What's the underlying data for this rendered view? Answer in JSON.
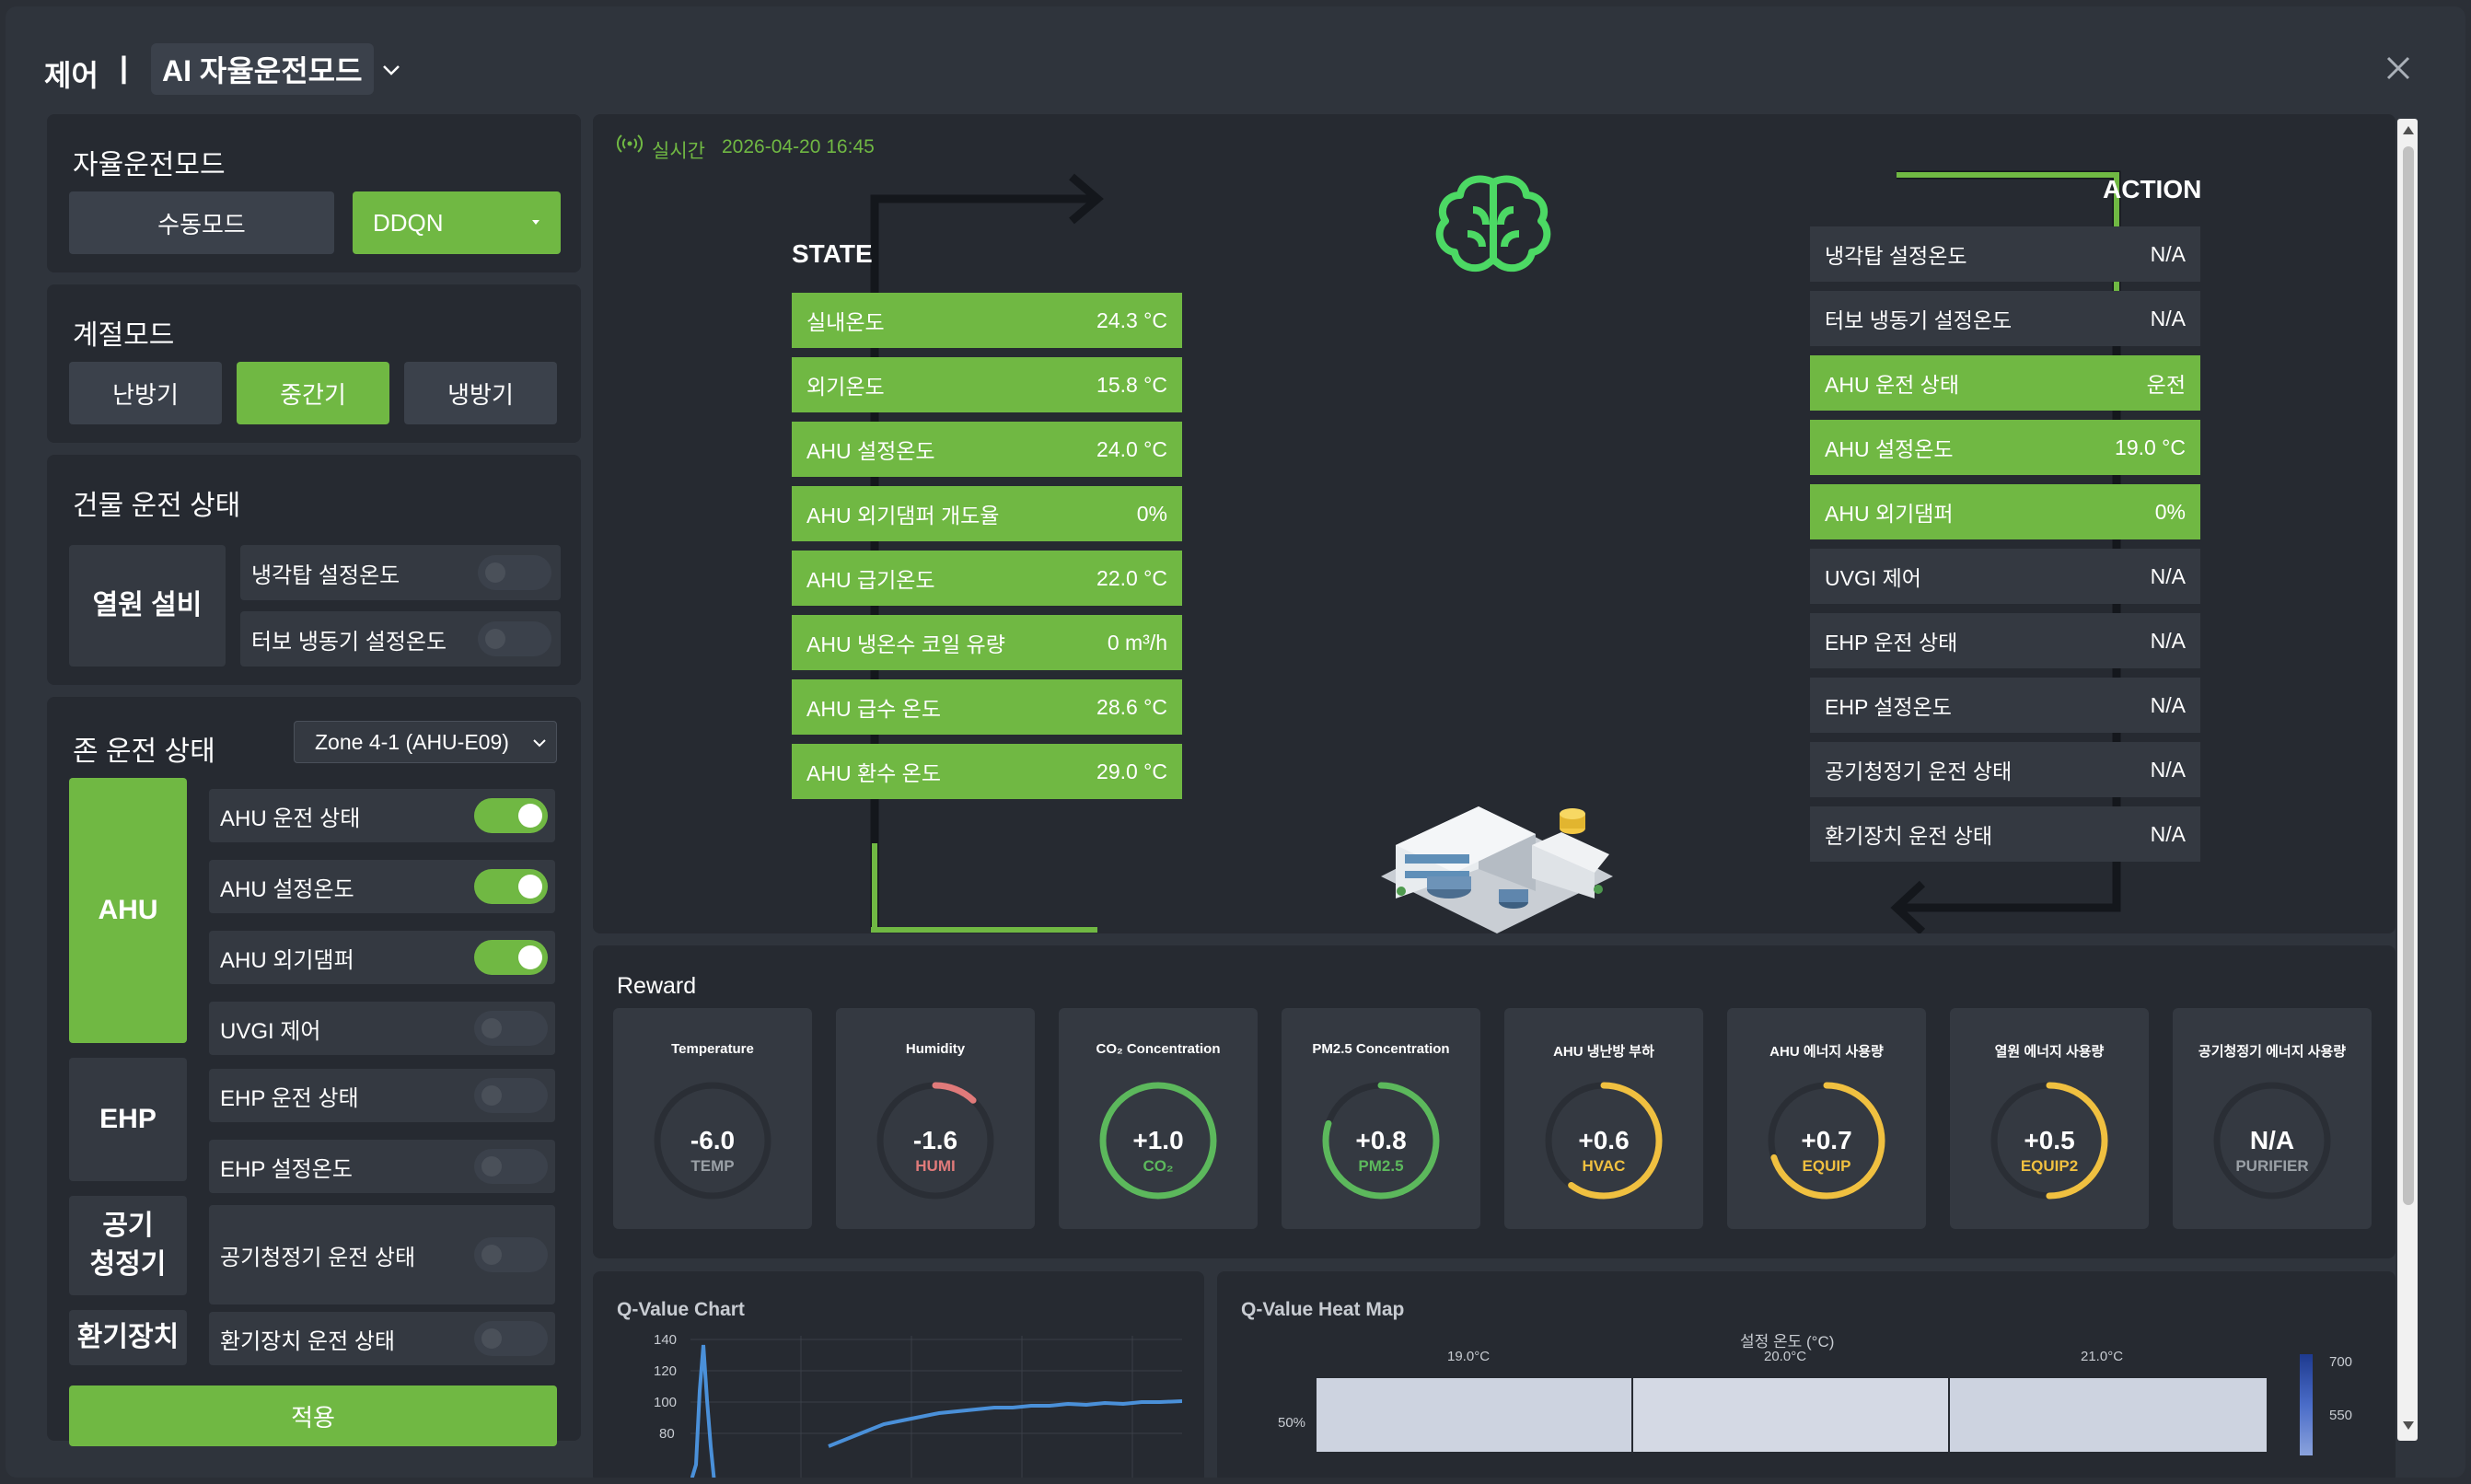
{
  "header": {
    "title": "제어",
    "separator": "|",
    "mode_select": "AI 자율운전모드"
  },
  "autonomous": {
    "title": "자율운전모드",
    "manual_label": "수동모드",
    "algorithm_select": "DDQN"
  },
  "season": {
    "title": "계절모드",
    "options": [
      "난방기",
      "중간기",
      "냉방기"
    ],
    "selected": "중간기"
  },
  "building": {
    "title": "건물 운전 상태",
    "category": "열원 설비",
    "items": [
      {
        "label": "냉각탑 설정온도",
        "on": false
      },
      {
        "label": "터보 냉동기 설정온도",
        "on": false
      }
    ]
  },
  "zone": {
    "title": "존 운전 상태",
    "zone_select": "Zone 4-1 (AHU-E09)",
    "groups": {
      "ahu": "AHU",
      "ehp": "EHP",
      "purifier": "공기\n청정기",
      "ventilator": "환기장치"
    },
    "items": [
      {
        "label": "AHU 운전 상태",
        "on": true
      },
      {
        "label": "AHU 설정온도",
        "on": true
      },
      {
        "label": "AHU 외기댐퍼",
        "on": true
      },
      {
        "label": "UVGI 제어",
        "on": false
      },
      {
        "label": "EHP 운전 상태",
        "on": false
      },
      {
        "label": "EHP 설정온도",
        "on": false
      },
      {
        "label": "공기청정기 운전 상태",
        "on": false
      },
      {
        "label": "환기장치 운전 상태",
        "on": false
      }
    ],
    "apply_label": "적용"
  },
  "realtime": {
    "icon": "broadcast-icon",
    "label": "실시간",
    "timestamp": "2026-04-20 16:45"
  },
  "state": {
    "title": "STATE",
    "items": [
      {
        "label": "실내온도",
        "value": "24.3 °C"
      },
      {
        "label": "외기온도",
        "value": "15.8 °C"
      },
      {
        "label": "AHU 설정온도",
        "value": "24.0 °C"
      },
      {
        "label": "AHU 외기댐퍼 개도율",
        "value": "0%"
      },
      {
        "label": "AHU 급기온도",
        "value": "22.0 °C"
      },
      {
        "label": "AHU 냉온수 코일 유량",
        "value": "0 m³/h"
      },
      {
        "label": "AHU 급수 온도",
        "value": "28.6 °C"
      },
      {
        "label": "AHU 환수 온도",
        "value": "29.0 °C"
      }
    ]
  },
  "action": {
    "title": "ACTION",
    "items": [
      {
        "label": "냉각탑 설정온도",
        "value": "N/A",
        "active": false
      },
      {
        "label": "터보 냉동기 설정온도",
        "value": "N/A",
        "active": false
      },
      {
        "label": "AHU 운전 상태",
        "value": "운전",
        "active": true
      },
      {
        "label": "AHU 설정온도",
        "value": "19.0 °C",
        "active": true
      },
      {
        "label": "AHU 외기댐퍼",
        "value": "0%",
        "active": true
      },
      {
        "label": "UVGI 제어",
        "value": "N/A",
        "active": false
      },
      {
        "label": "EHP 운전 상태",
        "value": "N/A",
        "active": false
      },
      {
        "label": "EHP 설정온도",
        "value": "N/A",
        "active": false
      },
      {
        "label": "공기청정기 운전 상태",
        "value": "N/A",
        "active": false
      },
      {
        "label": "환기장치 운전 상태",
        "value": "N/A",
        "active": false
      }
    ]
  },
  "reward": {
    "title": "Reward",
    "gauges": [
      {
        "title": "Temperature",
        "value": "-6.0",
        "label": "TEMP",
        "fraction": 0.0,
        "color": "#9aa0a6"
      },
      {
        "title": "Humidity",
        "value": "-1.6",
        "label": "HUMI",
        "fraction": 0.12,
        "color": "#e07a7a"
      },
      {
        "title": "CO₂ Concentration",
        "value": "+1.0",
        "label": "CO₂",
        "fraction": 1.0,
        "color": "#5cb85c"
      },
      {
        "title": "PM2.5 Concentration",
        "value": "+0.8",
        "label": "PM2.5",
        "fraction": 0.8,
        "color": "#5cb85c"
      },
      {
        "title": "AHU 냉난방 부하",
        "value": "+0.6",
        "label": "HVAC",
        "fraction": 0.6,
        "color": "#f0c040"
      },
      {
        "title": "AHU 에너지 사용량",
        "value": "+0.7",
        "label": "EQUIP",
        "fraction": 0.7,
        "color": "#f0c040"
      },
      {
        "title": "열원 에너지 사용량",
        "value": "+0.5",
        "label": "EQUIP2",
        "fraction": 0.5,
        "color": "#f0c040"
      },
      {
        "title": "공기청정기 에너지 사용량",
        "value": "N/A",
        "label": "PURIFIER",
        "fraction": 0.0,
        "color": "#9aa0a6"
      }
    ]
  },
  "qchart": {
    "title": "Q-Value Chart",
    "yticks": [
      "140",
      "120",
      "100",
      "80"
    ],
    "color": "#4a90d9"
  },
  "heatmap": {
    "title": "Q-Value Heat Map",
    "axis_title": "설정 온도 (°C)",
    "xticks": [
      "19.0°C",
      "20.0°C",
      "21.0°C"
    ],
    "ytick": "50%",
    "scale_ticks": [
      "700",
      "550"
    ]
  },
  "colors": {
    "accent": "#70b843",
    "panel": "#262a31",
    "row": "#343941"
  }
}
